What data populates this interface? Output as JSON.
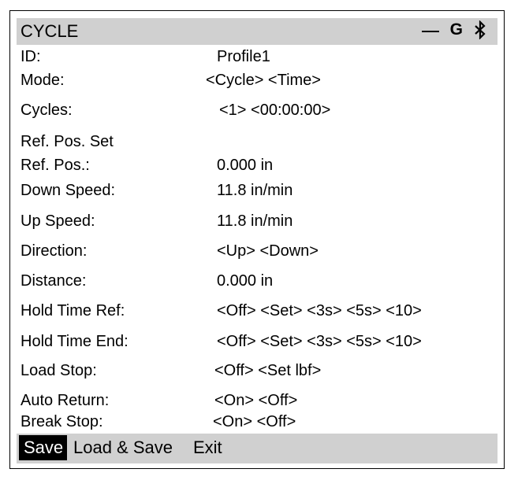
{
  "header": {
    "title": "CYCLE",
    "status_g": "G",
    "icons": [
      "minus-icon",
      "bluetooth-icon"
    ]
  },
  "rows": [
    {
      "label": "ID:",
      "value": "Profile1"
    },
    {
      "label": "Mode:",
      "value": "<Cycle> <Time>"
    },
    {
      "label": "Cycles:",
      "value": "<1> <00:00:00>"
    },
    {
      "label": "Ref. Pos. Set",
      "value": ""
    },
    {
      "label": "Ref. Pos.:",
      "value": "0.000 in"
    },
    {
      "label": "Down Speed:",
      "value": "11.8 in/min"
    },
    {
      "label": "Up Speed:",
      "value": "11.8 in/min"
    },
    {
      "label": "Direction:",
      "value": "<Up> <Down>"
    },
    {
      "label": "Distance:",
      "value": "0.000 in"
    },
    {
      "label": "Hold Time Ref:",
      "value": "<Off> <Set> <3s> <5s> <10>"
    },
    {
      "label": "Hold Time End:",
      "value": "<Off> <Set> <3s> <5s> <10>"
    },
    {
      "label": "Load Stop:",
      "value": "<Off> <Set lbf>"
    },
    {
      "label": "Auto Return:",
      "value": "<On> <Off>"
    },
    {
      "label": "Break Stop:",
      "value": "<On> <Off>"
    }
  ],
  "footer": {
    "save_label": "Save",
    "load_save_label": "Load & Save",
    "exit_label": "Exit"
  },
  "colors": {
    "bar_background": "#d0d0d0",
    "selected_background": "#000000",
    "selected_text": "#ffffff"
  }
}
